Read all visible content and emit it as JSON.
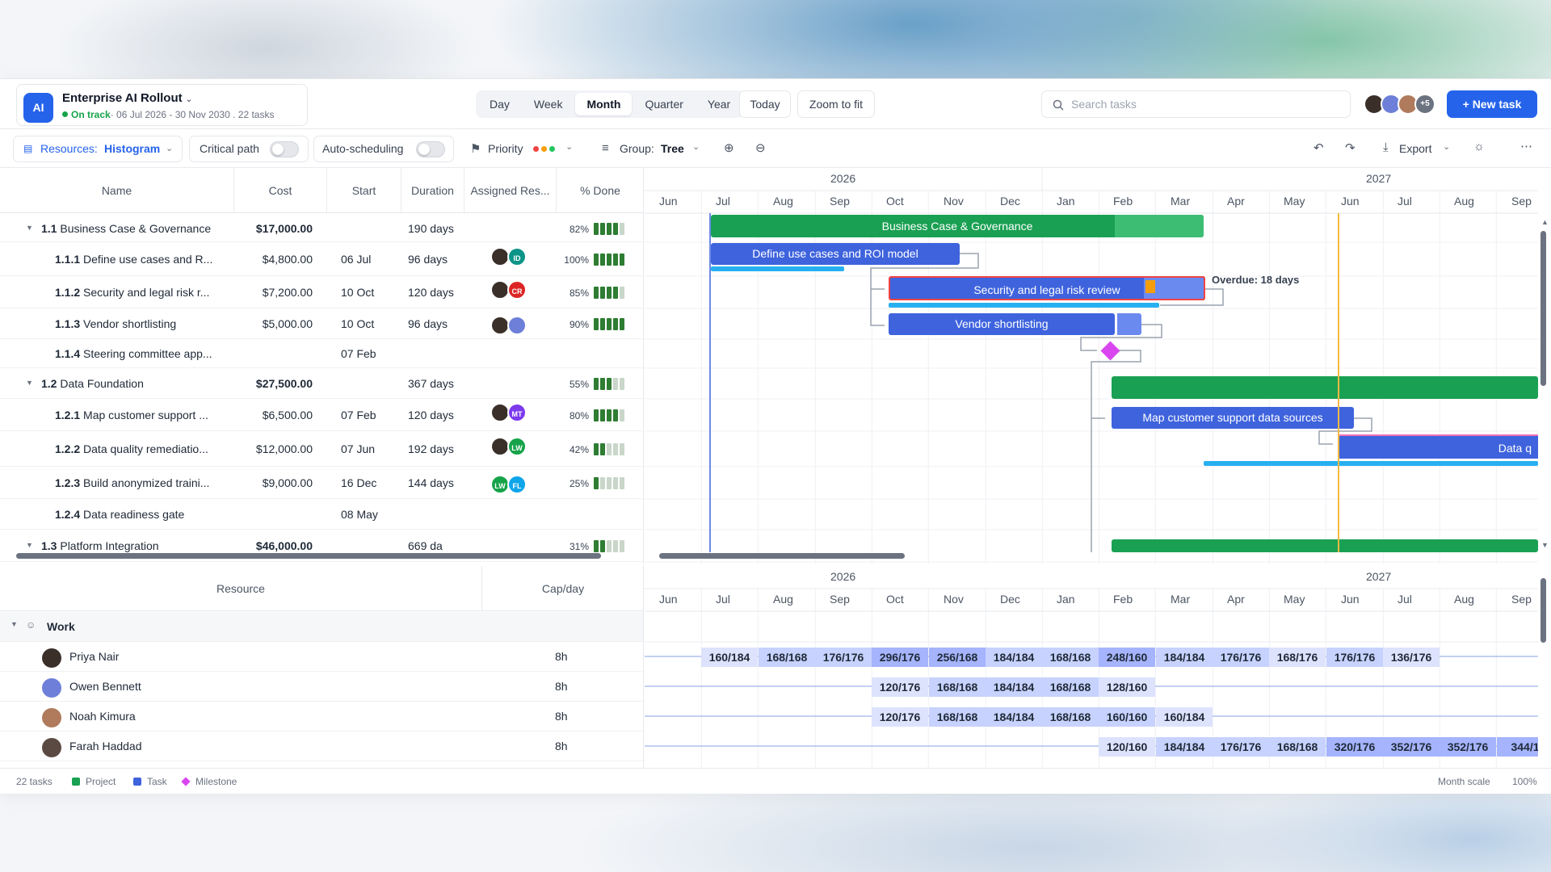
{
  "project": {
    "badge": "AI",
    "name": "Enterprise AI Rollout",
    "status": "On track",
    "meta": "· 06 Jul 2026 - 30 Nov 2030 . 22 tasks"
  },
  "views": [
    "Day",
    "Week",
    "Month",
    "Quarter",
    "Year"
  ],
  "active_view": "Month",
  "today_label": "Today",
  "zoom_fit_label": "Zoom to fit",
  "search": {
    "placeholder": "Search tasks"
  },
  "avatars_more": "+5",
  "new_task_label": "New task",
  "toolbar": {
    "resources_label": "Resources:",
    "resources_value": "Histogram",
    "critical_path": "Critical path",
    "auto_scheduling": "Auto-scheduling",
    "priority": "Priority",
    "group_label": "Group:",
    "group_value": "Tree",
    "export": "Export"
  },
  "columns": [
    "Name",
    "Cost",
    "Start",
    "Duration",
    "Assigned Res...",
    "% Done"
  ],
  "tasks": [
    {
      "id": "1.1",
      "name": "Business Case & Governance",
      "cost": "$17,000.00",
      "start": "",
      "duration": "190 days",
      "done": "82%",
      "level": 0
    },
    {
      "id": "1.1.1",
      "name": "Define use cases and R...",
      "cost": "$4,800.00",
      "start": "06 Jul",
      "duration": "96 days",
      "done": "100%",
      "level": 1,
      "res": [
        "ID"
      ]
    },
    {
      "id": "1.1.2",
      "name": "Security and legal risk r...",
      "cost": "$7,200.00",
      "start": "10 Oct",
      "duration": "120 days",
      "done": "85%",
      "level": 1,
      "res": [
        "CR"
      ]
    },
    {
      "id": "1.1.3",
      "name": "Vendor shortlisting",
      "cost": "$5,000.00",
      "start": "10 Oct",
      "duration": "96 days",
      "done": "90%",
      "level": 1,
      "res": []
    },
    {
      "id": "1.1.4",
      "name": "Steering committee app...",
      "cost": "",
      "start": "07 Feb",
      "duration": "",
      "done": "",
      "level": 1
    },
    {
      "id": "1.2",
      "name": "Data Foundation",
      "cost": "$27,500.00",
      "start": "",
      "duration": "367 days",
      "done": "55%",
      "level": 0
    },
    {
      "id": "1.2.1",
      "name": "Map customer support ...",
      "cost": "$6,500.00",
      "start": "07 Feb",
      "duration": "120 days",
      "done": "80%",
      "level": 1,
      "res": [
        "MT"
      ]
    },
    {
      "id": "1.2.2",
      "name": "Data quality remediatio...",
      "cost": "$12,000.00",
      "start": "07 Jun",
      "duration": "192 days",
      "done": "42%",
      "level": 1,
      "res": [
        "LW"
      ]
    },
    {
      "id": "1.2.3",
      "name": "Build anonymized traini...",
      "cost": "$9,000.00",
      "start": "16 Dec",
      "duration": "144 days",
      "done": "25%",
      "level": 1,
      "res": [
        "LW",
        "FL"
      ]
    },
    {
      "id": "1.2.4",
      "name": "Data readiness gate",
      "cost": "",
      "start": "08 May",
      "duration": "",
      "done": "",
      "level": 1
    },
    {
      "id": "1.3",
      "name": "Platform Integration",
      "cost": "$46,000.00",
      "start": "",
      "duration": "669 da",
      "done": "31%",
      "level": 0
    }
  ],
  "timeline": {
    "years": [
      "2026",
      "2027"
    ],
    "months": [
      "Jun",
      "Jul",
      "Aug",
      "Sep",
      "Oct",
      "Nov",
      "Dec",
      "Jan",
      "Feb",
      "Mar",
      "Apr",
      "May",
      "Jun",
      "Jul",
      "Aug",
      "Sep"
    ],
    "bars": {
      "b1": "Business Case & Governance",
      "b2": "Define use cases and ROI model",
      "b3": "Security and legal risk review",
      "b4": "Vendor shortlisting",
      "b5": "Map customer support data sources",
      "b6": "Data q"
    },
    "overdue": "Overdue: 18 days"
  },
  "resources": {
    "columns": [
      "Resource",
      "Cap/day"
    ],
    "group": "Work",
    "people": [
      {
        "name": "Priya Nair",
        "cap": "8h"
      },
      {
        "name": "Owen Bennett",
        "cap": "8h"
      },
      {
        "name": "Noah Kimura",
        "cap": "8h"
      },
      {
        "name": "Farah Haddad",
        "cap": "8h"
      }
    ],
    "hist": [
      [
        "160/184",
        "168/168",
        "176/176",
        "296/176",
        "256/168",
        "184/184",
        "168/168",
        "248/160",
        "184/184",
        "176/176",
        "168/176",
        "176/176",
        "136/176"
      ],
      [
        "120/176",
        "168/168",
        "184/184",
        "168/168",
        "128/160"
      ],
      [
        "120/176",
        "168/168",
        "184/184",
        "168/168",
        "160/160",
        "160/184"
      ],
      [
        "120/160",
        "184/184",
        "176/176",
        "168/168",
        "320/176",
        "352/176",
        "352/176",
        "344/1"
      ]
    ]
  },
  "footer": {
    "count": "22 tasks",
    "legend": [
      "Project",
      "Task",
      "Milestone"
    ],
    "scale": "Month scale",
    "zoom": "100%"
  },
  "colors": {
    "accent": "#2563eb",
    "project": "#1aa053",
    "task": "#3e63dd",
    "milestone": "#d946ef",
    "today_line": "#f59e0b"
  }
}
